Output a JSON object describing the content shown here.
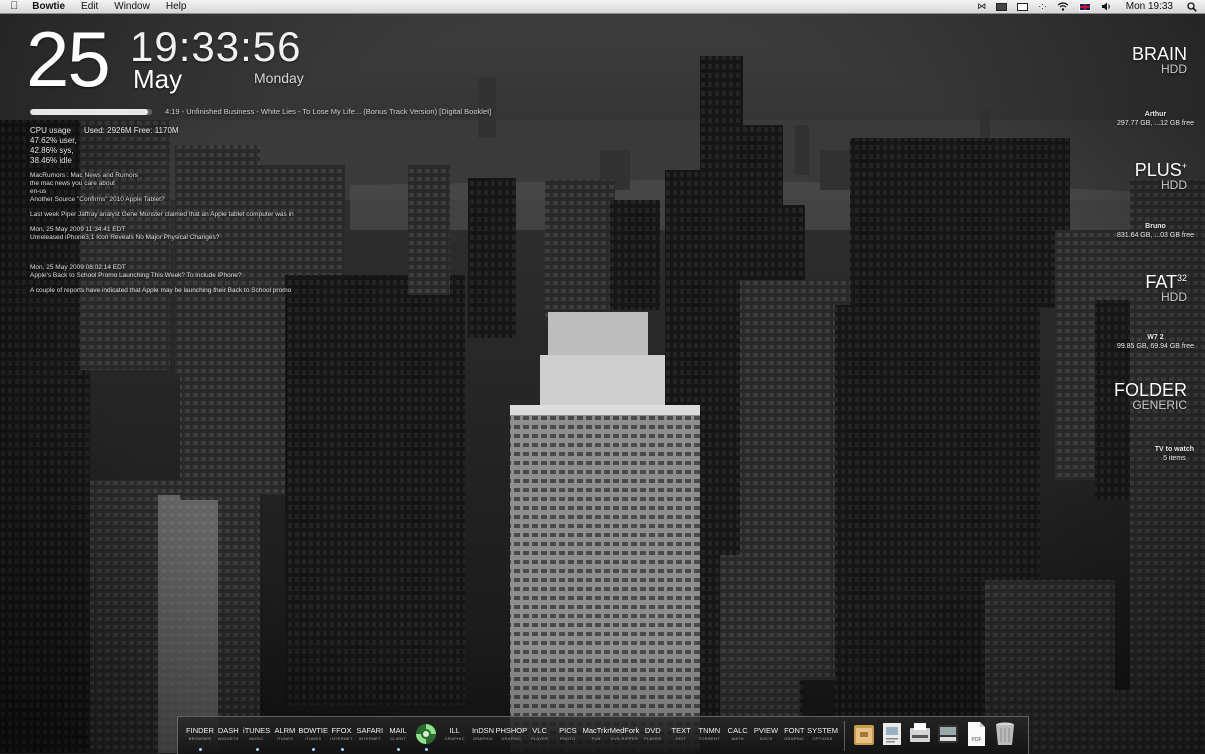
{
  "menubar": {
    "apple": "",
    "app_name": "Bowtie",
    "menus": [
      "Edit",
      "Window",
      "Help"
    ],
    "clock": "Mon 19:33",
    "status_icons": [
      "bowtie-icon",
      "battery-icon",
      "display-icon",
      "dots-icon",
      "wifi-icon",
      "uk-flag-icon",
      "volume-icon",
      "spotlight-icon"
    ]
  },
  "datetime": {
    "day": "25",
    "time": "19:33:56",
    "month": "May",
    "weekday": "Monday"
  },
  "now_playing": {
    "text": "4:19 - Unfinished Business - White Lies - To Lose My Life... (Bonus Track Version) [Digital Booklet]",
    "progress": 0.97
  },
  "cpu": {
    "label": "CPU usage",
    "mem": "Used: 2926M Free: 1170M",
    "user": "47.62% user,",
    "sys": "42.86% sys,",
    "idle": "38.46% idle"
  },
  "news": {
    "lines": [
      "MacRumors : Mac News and Rumors",
      "the mac news you care about",
      "en-us",
      "Another Source \"Confirms\" 2010 Apple Tablet?",
      "Last week Piper Jaffray analyst Gene Munster claimed that an Apple tablet computer was in",
      "Mon, 25 May 2009 11:34:41 EDT",
      "Unreleased iPhone3,1 Icon Reveals No Major Physical Changes?",
      "Mon, 25 May 2009 08:02:14 EDT",
      "Apple's Back to School Promo Launching This Week? To include iPhone?",
      "A couple of reports have indicated that Apple may be launching their Back to School promo"
    ]
  },
  "drives": [
    {
      "name": "BRAIN",
      "sup": "",
      "sub": "HDD",
      "user": "Arthur",
      "info": "297.77 GB, ...12 GB free"
    },
    {
      "name": "PLUS",
      "sup": "+",
      "sub": "HDD",
      "user": "Bruno",
      "info": "831.64 GB, ...03 GB free"
    },
    {
      "name": "FAT",
      "sup": "32",
      "sub": "HDD",
      "user": "W7 2",
      "info": "99.85 GB, 69.94 GB free"
    },
    {
      "name": "FOLDER",
      "sup": "",
      "sub": "GENERIC",
      "user": "TV to watch",
      "info": "5 items"
    }
  ],
  "dock": {
    "apps": [
      {
        "label": "FINDER",
        "sub": "BROWSER",
        "running": true
      },
      {
        "label": "DASH",
        "sub": "WIDGETS",
        "running": false
      },
      {
        "label": "iTUNES",
        "sub": "MUSIC",
        "running": true
      },
      {
        "label": "ALRM",
        "sub": "ITUNES",
        "running": false
      },
      {
        "label": "BOWTIE",
        "sub": "ITUNES",
        "running": true
      },
      {
        "label": "FFOX",
        "sub": "INTERNET",
        "running": true
      },
      {
        "label": "SAFARI",
        "sub": "INTERNET",
        "running": false
      },
      {
        "label": "MAIL",
        "sub": "CLIENT",
        "running": true
      },
      {
        "label": "",
        "sub": "",
        "running": true
      },
      {
        "label": "ILL",
        "sub": "GRAPHIC",
        "running": false
      },
      {
        "label": "InDSN",
        "sub": "GRAPHIC",
        "running": false
      },
      {
        "label": "PHSHOP",
        "sub": "GRAPHIC",
        "running": false
      },
      {
        "label": "VLC",
        "sub": "PLAYER",
        "running": false
      },
      {
        "label": "PICS",
        "sub": "PHOTO",
        "running": false
      },
      {
        "label": "MacTrkr",
        "sub": "FUN",
        "running": false
      },
      {
        "label": "MedFork",
        "sub": "DVD RIPPER",
        "running": false
      },
      {
        "label": "DVD",
        "sub": "PLAYER",
        "running": false
      },
      {
        "label": "TEXT",
        "sub": "EDIT",
        "running": false
      },
      {
        "label": "TNMN",
        "sub": "TORRENT",
        "running": false
      },
      {
        "label": "CALC",
        "sub": "MATH",
        "running": false
      },
      {
        "label": "PVIEW",
        "sub": "DOCS",
        "running": false
      },
      {
        "label": "FONT",
        "sub": "GRAPHIC",
        "running": false
      },
      {
        "label": "SYSTEM",
        "sub": "OPTIONS",
        "running": false
      }
    ],
    "docs": [
      "folder-icon",
      "preview-doc-icon",
      "printer-icon",
      "scanner-icon",
      "pdf-icon",
      "trash-icon"
    ],
    "pdf_label": "PDF"
  }
}
